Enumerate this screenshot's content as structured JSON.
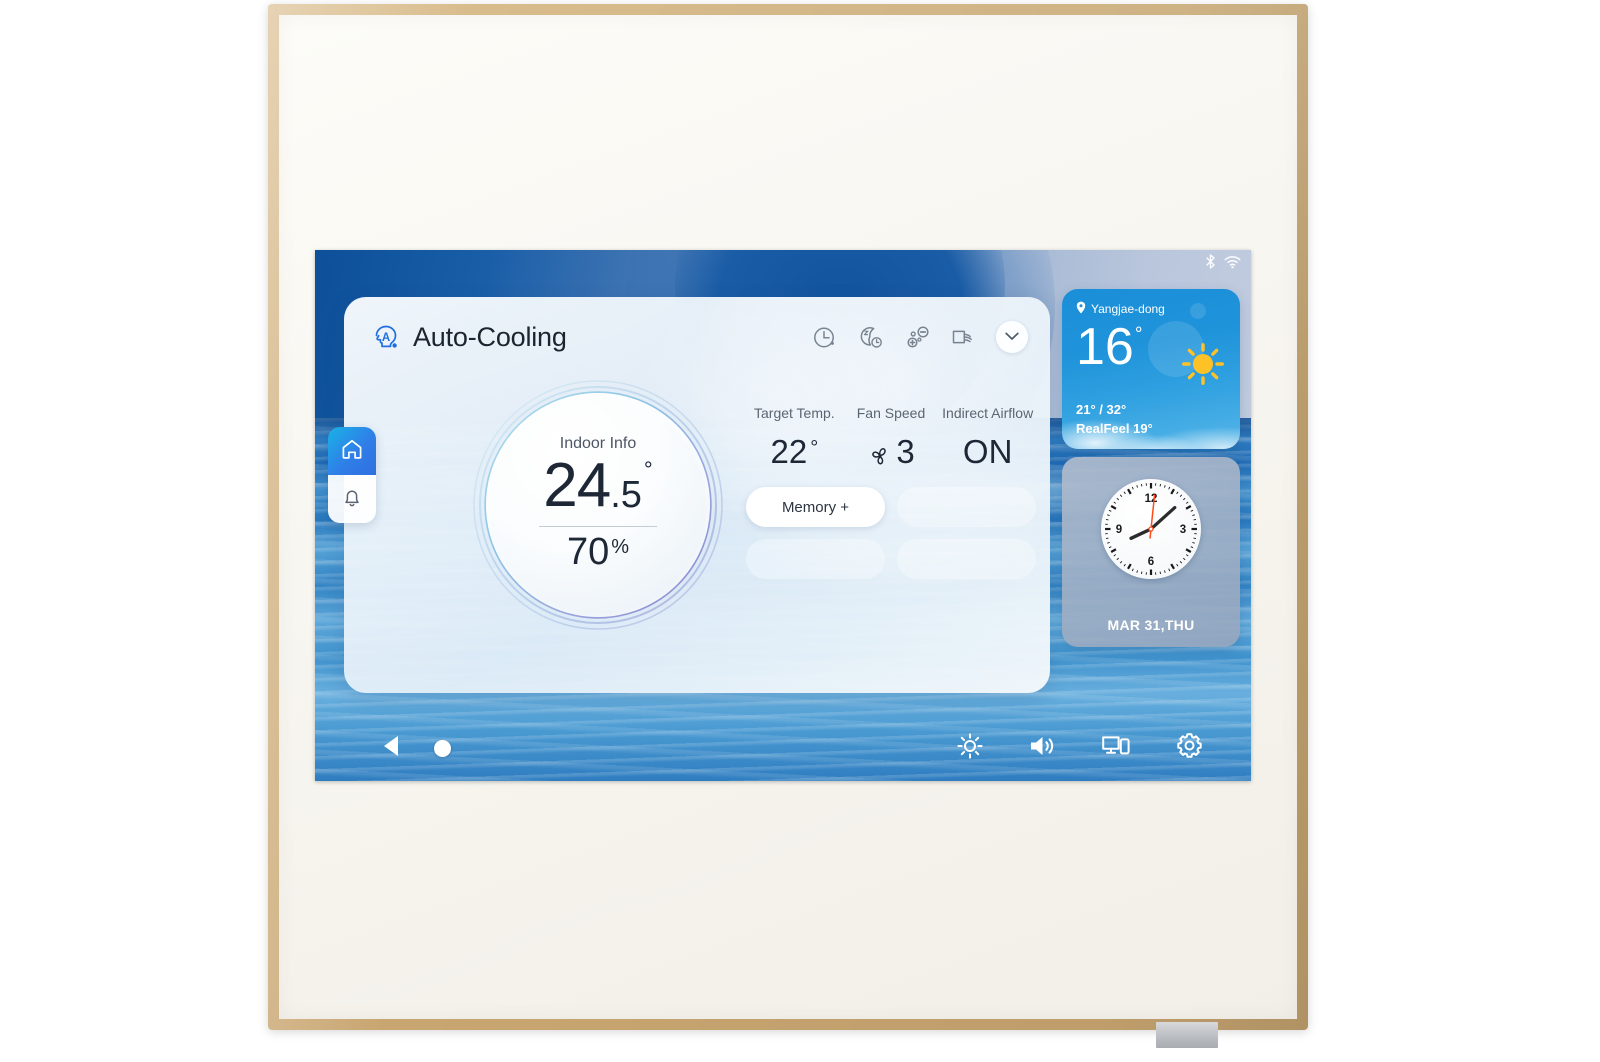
{
  "device": {
    "frame_color": "#cfae79",
    "panel_color": "#f7f5ef"
  },
  "statusbar": {
    "bluetooth_icon": "bluetooth-icon",
    "wifi_icon": "wifi-icon"
  },
  "card": {
    "mode_icon": "auto-mode-icon",
    "title": "Auto-Cooling",
    "head_icons": [
      {
        "name": "timer-icon",
        "label": "Timer"
      },
      {
        "name": "sleep-timer-icon",
        "label": "Sleep Timer"
      },
      {
        "name": "ionizer-icon",
        "label": "Ionizer"
      },
      {
        "name": "airflow-icon",
        "label": "Airflow"
      }
    ],
    "expand_icon": "chevron-down-icon"
  },
  "dial": {
    "label": "Indoor Info",
    "temp_int": "24",
    "temp_dec": ".5",
    "temp_deg": "°",
    "humidity": "70",
    "humidity_unit": "%",
    "ring_start_color": "#9fd6ea",
    "ring_end_color": "#8f8fd2"
  },
  "readouts": [
    {
      "label": "Target Temp.",
      "value": "22",
      "unit": "°",
      "icon": ""
    },
    {
      "label": "Fan Speed",
      "value": "3",
      "unit": "",
      "icon": "fan-icon"
    },
    {
      "label": "Indirect Airflow",
      "value": "ON",
      "unit": "",
      "icon": ""
    }
  ],
  "pills": [
    {
      "label": "Memory +",
      "active": true
    },
    {
      "label": "",
      "active": false
    },
    {
      "label": "",
      "active": false
    },
    {
      "label": "",
      "active": false
    }
  ],
  "sidebar": {
    "items": [
      {
        "name": "sidebar-item-home",
        "icon": "home-icon",
        "active": true
      },
      {
        "name": "sidebar-item-notifications",
        "icon": "bell-icon",
        "active": false
      }
    ],
    "active_color": "#2f7fe8"
  },
  "weather": {
    "location_icon": "location-pin-icon",
    "location": "Yangjae-dong",
    "temperature": "16",
    "degree": "°",
    "condition_icon": "sun-icon",
    "high_low": "21° / 32°",
    "realfeel": "RealFeel 19°",
    "accent": "#1f93da"
  },
  "clock": {
    "numerals": [
      "12",
      "3",
      "6",
      "9"
    ],
    "hour_angle": -115,
    "minute_angle": 48,
    "second_angle": 6,
    "date": "MAR 31,THU",
    "second_hand_color": "#ff4a1a"
  },
  "navbar": {
    "back_icon": "back-triangle-icon",
    "home_icon": "home-circle-icon",
    "right_items": [
      {
        "name": "brightness-icon",
        "label": "Brightness"
      },
      {
        "name": "volume-icon",
        "label": "Volume"
      },
      {
        "name": "cast-screen-icon",
        "label": "Screen Share"
      },
      {
        "name": "settings-gear-icon",
        "label": "Settings"
      }
    ]
  }
}
